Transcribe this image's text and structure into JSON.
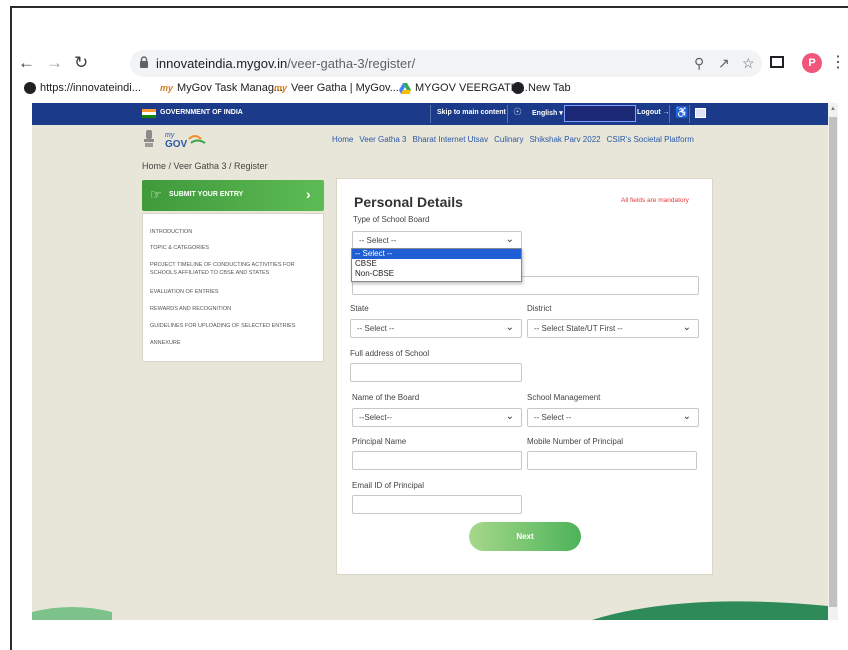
{
  "browser": {
    "url_domain": "innovateindia.mygov.in",
    "url_path": "/veer-gatha-3/register/",
    "profile_initial": "P",
    "bookmarks": [
      {
        "label": "https://innovateindi...",
        "icon": "globe-icon"
      },
      {
        "label": "MyGov Task Manag...",
        "icon": "mygov-icon"
      },
      {
        "label": "Veer Gatha | MyGov...",
        "icon": "mygov-icon"
      },
      {
        "label": "MYGOV VEERGATH...",
        "icon": "google-drive-icon"
      },
      {
        "label": "New Tab",
        "icon": "globe-icon"
      }
    ]
  },
  "govbar": {
    "title": "GOVERNMENT OF INDIA",
    "skip_link": "Skip to main content",
    "language": "English ▾",
    "logout": "Logout →"
  },
  "nav": {
    "items": [
      "Home",
      "Veer Gatha 3",
      "Bharat Internet Utsav",
      "Culinary",
      "Shikshak Parv 2022",
      "CSIR's Societal Platform"
    ]
  },
  "breadcrumb": "Home / Veer Gatha 3 / Register",
  "sidebar": {
    "submit_label": "SUBMIT YOUR ENTRY",
    "items": [
      "INTRODUCTION",
      "TOPIC & CATEGORIES",
      "PROJECT TIMELINE OF CONDUCTING ACTIVITIES FOR SCHOOLS AFFILIATED TO CBSE AND STATES",
      "EVALUATION OF ENTRIES",
      "REWARDS AND RECOGNITION",
      "GUIDELINES FOR UPLOADING OF SELECTED ENTRIES",
      "ANNEXURE"
    ]
  },
  "form": {
    "title": "Personal Details",
    "mandatory_note": "All fields are mandatory",
    "school_board_label": "Type of School Board",
    "school_board_value": "-- Select --",
    "school_board_options": [
      "-- Select --",
      "CBSE",
      "Non-CBSE"
    ],
    "state_label": "State",
    "state_value": "-- Select --",
    "district_label": "District",
    "district_value": "-- Select State/UT First --",
    "address_label": "Full address of School",
    "board_name_label": "Name of the Board",
    "board_name_value": "--Select--",
    "management_label": "School Management",
    "management_value": "-- Select --",
    "principal_name_label": "Principal Name",
    "principal_mobile_label": "Mobile Number of Principal",
    "principal_email_label": "Email ID of Principal",
    "next_label": "Next"
  },
  "colors": {
    "govbar": "#1b3b8a",
    "accent_green": "#4cae4c",
    "link_blue": "#2a58a8",
    "page_bg": "#e8e6d8"
  }
}
